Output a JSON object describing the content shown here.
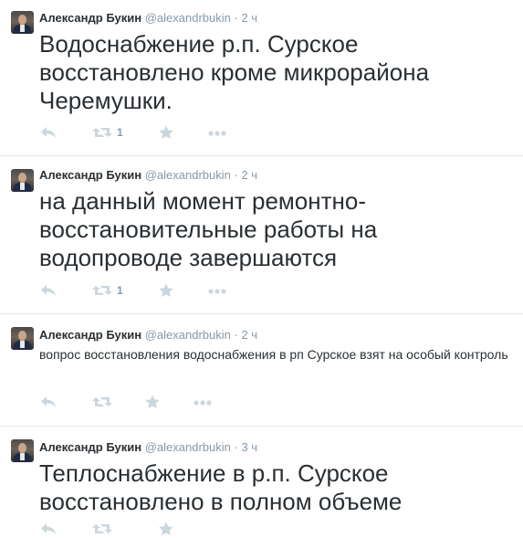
{
  "tweets": [
    {
      "name": "Александр Букин",
      "handle": "@alexandrbukin",
      "separator": "·",
      "time": "2 ч",
      "text": "Водоснабжение р.п. Сурское восстановлено кроме микрорайона Черемушки.",
      "retweets": "1"
    },
    {
      "name": "Александр Букин",
      "handle": "@alexandrbukin",
      "separator": "·",
      "time": "2 ч",
      "text": "на данный момент ремонтно-восстановительные работы на водопроводе завершаются",
      "retweets": "1"
    },
    {
      "name": "Александр Букин",
      "handle": "@alexandrbukin",
      "separator": "·",
      "time": "2 ч",
      "text": "вопрос восстановления водоснабжения в рп Сурское взят на особый контроль",
      "retweets": ""
    },
    {
      "name": "Александр Букин",
      "handle": "@alexandrbukin",
      "separator": "·",
      "time": "3 ч",
      "text": "Теплоснабжение в р.п. Сурское восстановлено в полном объеме",
      "retweets": ""
    }
  ],
  "icons": {
    "reply": "reply-icon",
    "retweet": "retweet-icon",
    "favorite": "star-icon",
    "more": "more-icon"
  },
  "colors": {
    "text": "#292f33",
    "muted": "#8899a6",
    "action_icons": "#ccd6dd",
    "divider": "#e1e8ed"
  }
}
